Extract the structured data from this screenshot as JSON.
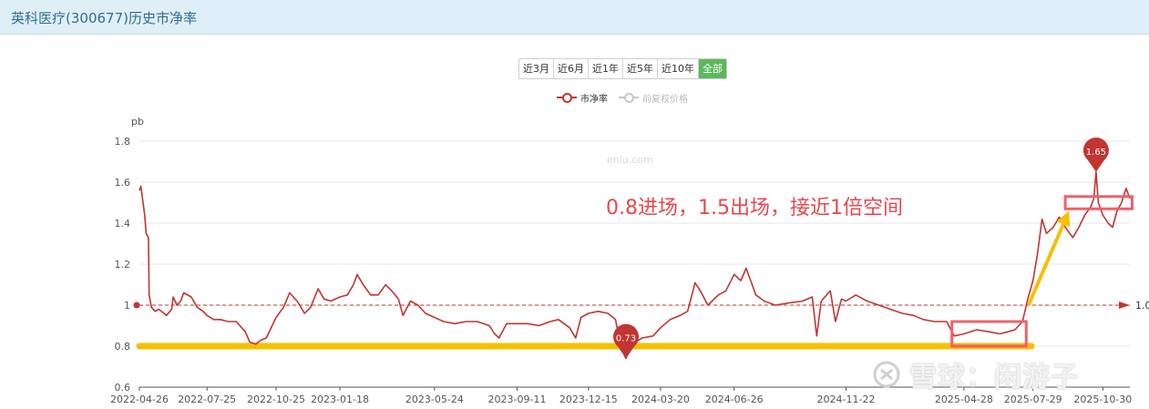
{
  "header": {
    "title": "英科医疗(300677)历史市净率"
  },
  "range_tabs": [
    {
      "label": "近3月",
      "active": false
    },
    {
      "label": "近6月",
      "active": false
    },
    {
      "label": "近1年",
      "active": false
    },
    {
      "label": "近5年",
      "active": false
    },
    {
      "label": "近10年",
      "active": false
    },
    {
      "label": "全部",
      "active": true
    }
  ],
  "legend": {
    "pb_label": "市净率",
    "price_label": "前复权价格"
  },
  "annotation": {
    "text": "0.8进场，1.5出场，接近1倍空间"
  },
  "watermark": {
    "site": "eniu.com",
    "xueqiu": "雪球：闲游子"
  },
  "colors": {
    "series": "#c23531",
    "highlight_box": "#f0606a",
    "support_line": "#f5c000",
    "arrow": "#f5c000"
  },
  "chart_data": {
    "type": "line",
    "ylabel": "pb",
    "ylim": [
      0.6,
      1.8
    ],
    "yticks": [
      "0.6",
      "0.8",
      "1",
      "1.2",
      "1.4",
      "1.6",
      "1.8"
    ],
    "x_tick_labels": [
      "2022-04-26",
      "2022-07-25",
      "2022-10-25",
      "2023-01-18",
      "2023-05-24",
      "2023-09-11",
      "2023-12-15",
      "2024-03-20",
      "2024-06-26",
      "2024-11-22",
      "2025-04-28",
      "2025-07-29",
      "2025-10-30"
    ],
    "x_range": [
      "2022-04-26",
      "2025-12-05"
    ],
    "series": [
      {
        "name": "市净率",
        "points": [
          [
            "2022-04-26",
            1.56
          ],
          [
            "2022-04-28",
            1.58
          ],
          [
            "2022-05-03",
            1.44
          ],
          [
            "2022-05-05",
            1.35
          ],
          [
            "2022-05-08",
            1.33
          ],
          [
            "2022-05-09",
            1.05
          ],
          [
            "2022-05-12",
            0.99
          ],
          [
            "2022-05-17",
            0.97
          ],
          [
            "2022-05-22",
            0.98
          ],
          [
            "2022-06-01",
            0.95
          ],
          [
            "2022-06-08",
            0.98
          ],
          [
            "2022-06-10",
            1.04
          ],
          [
            "2022-06-15",
            1.0
          ],
          [
            "2022-06-20",
            1.02
          ],
          [
            "2022-06-24",
            1.06
          ],
          [
            "2022-07-04",
            1.04
          ],
          [
            "2022-07-12",
            0.99
          ],
          [
            "2022-07-20",
            0.97
          ],
          [
            "2022-07-25",
            0.95
          ],
          [
            "2022-08-03",
            0.93
          ],
          [
            "2022-08-12",
            0.93
          ],
          [
            "2022-08-22",
            0.92
          ],
          [
            "2022-09-02",
            0.92
          ],
          [
            "2022-09-14",
            0.87
          ],
          [
            "2022-09-20",
            0.82
          ],
          [
            "2022-09-28",
            0.81
          ],
          [
            "2022-10-05",
            0.83
          ],
          [
            "2022-10-12",
            0.84
          ],
          [
            "2022-10-25",
            0.94
          ],
          [
            "2022-11-04",
            0.99
          ],
          [
            "2022-11-12",
            1.06
          ],
          [
            "2022-11-22",
            1.02
          ],
          [
            "2022-12-02",
            0.96
          ],
          [
            "2022-12-10",
            0.99
          ],
          [
            "2022-12-20",
            1.08
          ],
          [
            "2022-12-28",
            1.03
          ],
          [
            "2023-01-06",
            1.02
          ],
          [
            "2023-01-18",
            1.04
          ],
          [
            "2023-01-28",
            1.05
          ],
          [
            "2023-02-05",
            1.1
          ],
          [
            "2023-02-10",
            1.15
          ],
          [
            "2023-02-18",
            1.1
          ],
          [
            "2023-02-28",
            1.05
          ],
          [
            "2023-03-10",
            1.05
          ],
          [
            "2023-03-20",
            1.1
          ],
          [
            "2023-03-28",
            1.07
          ],
          [
            "2023-04-06",
            1.03
          ],
          [
            "2023-04-12",
            0.95
          ],
          [
            "2023-04-22",
            1.02
          ],
          [
            "2023-05-02",
            1.0
          ],
          [
            "2023-05-12",
            0.96
          ],
          [
            "2023-05-24",
            0.94
          ],
          [
            "2023-06-05",
            0.92
          ],
          [
            "2023-06-20",
            0.91
          ],
          [
            "2023-07-05",
            0.92
          ],
          [
            "2023-07-20",
            0.92
          ],
          [
            "2023-08-05",
            0.9
          ],
          [
            "2023-08-12",
            0.86
          ],
          [
            "2023-08-18",
            0.84
          ],
          [
            "2023-08-28",
            0.91
          ],
          [
            "2023-09-11",
            0.91
          ],
          [
            "2023-09-25",
            0.91
          ],
          [
            "2023-10-10",
            0.9
          ],
          [
            "2023-10-25",
            0.92
          ],
          [
            "2023-11-05",
            0.93
          ],
          [
            "2023-11-20",
            0.89
          ],
          [
            "2023-11-28",
            0.84
          ],
          [
            "2023-12-05",
            0.94
          ],
          [
            "2023-12-15",
            0.96
          ],
          [
            "2023-12-28",
            0.97
          ],
          [
            "2024-01-10",
            0.96
          ],
          [
            "2024-01-20",
            0.93
          ],
          [
            "2024-01-26",
            0.82
          ],
          [
            "2024-01-30",
            0.77
          ],
          [
            "2024-02-03",
            0.74
          ],
          [
            "2024-02-07",
            0.78
          ],
          [
            "2024-02-15",
            0.82
          ],
          [
            "2024-02-25",
            0.84
          ],
          [
            "2024-03-10",
            0.85
          ],
          [
            "2024-03-20",
            0.89
          ],
          [
            "2024-04-02",
            0.93
          ],
          [
            "2024-04-15",
            0.95
          ],
          [
            "2024-04-25",
            0.97
          ],
          [
            "2024-05-05",
            1.11
          ],
          [
            "2024-05-12",
            1.07
          ],
          [
            "2024-05-22",
            1.0
          ],
          [
            "2024-06-05",
            1.05
          ],
          [
            "2024-06-15",
            1.07
          ],
          [
            "2024-06-26",
            1.15
          ],
          [
            "2024-07-05",
            1.12
          ],
          [
            "2024-07-12",
            1.18
          ],
          [
            "2024-07-18",
            1.12
          ],
          [
            "2024-07-25",
            1.05
          ],
          [
            "2024-08-05",
            1.02
          ],
          [
            "2024-08-20",
            1.0
          ],
          [
            "2024-09-05",
            1.01
          ],
          [
            "2024-09-25",
            1.02
          ],
          [
            "2024-10-08",
            1.04
          ],
          [
            "2024-10-14",
            0.85
          ],
          [
            "2024-10-20",
            1.02
          ],
          [
            "2024-11-01",
            1.07
          ],
          [
            "2024-11-08",
            0.92
          ],
          [
            "2024-11-16",
            1.03
          ],
          [
            "2024-11-22",
            1.02
          ],
          [
            "2024-12-05",
            1.05
          ],
          [
            "2024-12-20",
            1.02
          ],
          [
            "2025-01-05",
            1.0
          ],
          [
            "2025-01-20",
            0.98
          ],
          [
            "2025-02-05",
            0.96
          ],
          [
            "2025-02-20",
            0.95
          ],
          [
            "2025-03-05",
            0.93
          ],
          [
            "2025-03-20",
            0.92
          ],
          [
            "2025-04-05",
            0.92
          ],
          [
            "2025-04-15",
            0.85
          ],
          [
            "2025-04-28",
            0.86
          ],
          [
            "2025-05-15",
            0.88
          ],
          [
            "2025-06-01",
            0.87
          ],
          [
            "2025-06-15",
            0.86
          ],
          [
            "2025-06-25",
            0.87
          ],
          [
            "2025-07-05",
            0.88
          ],
          [
            "2025-07-15",
            0.92
          ],
          [
            "2025-07-22",
            1.03
          ],
          [
            "2025-07-29",
            1.12
          ],
          [
            "2025-08-04",
            1.25
          ],
          [
            "2025-08-10",
            1.42
          ],
          [
            "2025-08-16",
            1.35
          ],
          [
            "2025-08-25",
            1.38
          ],
          [
            "2025-09-02",
            1.43
          ],
          [
            "2025-09-10",
            1.38
          ],
          [
            "2025-09-20",
            1.33
          ],
          [
            "2025-09-28",
            1.38
          ],
          [
            "2025-10-06",
            1.44
          ],
          [
            "2025-10-14",
            1.48
          ],
          [
            "2025-10-18",
            1.52
          ],
          [
            "2025-10-21",
            1.65
          ],
          [
            "2025-10-24",
            1.5
          ],
          [
            "2025-10-30",
            1.44
          ],
          [
            "2025-11-06",
            1.4
          ],
          [
            "2025-11-12",
            1.38
          ],
          [
            "2025-11-18",
            1.46
          ],
          [
            "2025-11-24",
            1.5
          ],
          [
            "2025-11-30",
            1.57
          ],
          [
            "2025-12-05",
            1.52
          ]
        ]
      }
    ],
    "markers": [
      {
        "label": "1.65",
        "date": "2025-10-21",
        "value": 1.65
      },
      {
        "label": "0.73",
        "date": "2024-02-03",
        "value": 0.74
      }
    ],
    "mark_line": {
      "value": 1.0,
      "label": "1.0"
    },
    "highlight_boxes": [
      {
        "from": "2025-04-12",
        "to": "2025-07-20",
        "y_from": 0.8,
        "y_to": 0.92
      },
      {
        "from": "2025-09-10",
        "to": "2025-12-08",
        "y_from": 1.47,
        "y_to": 1.53
      }
    ],
    "support_line": {
      "value": 0.8,
      "from": "2022-04-26",
      "to": "2025-07-27"
    },
    "arrow": {
      "from": [
        "2025-07-23",
        1.0
      ],
      "to": [
        "2025-09-15",
        1.46
      ]
    }
  }
}
